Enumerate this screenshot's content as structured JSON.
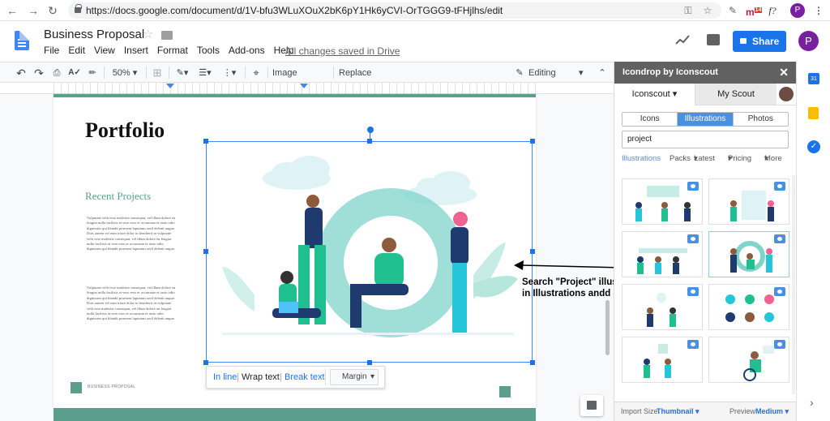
{
  "browser": {
    "url": "https://docs.google.com/document/d/1V-bfu3WLuXOuX2bK6pY1Hk6yCVI-OrTGGG9-tFHjlhs/edit",
    "ext_f": "f?",
    "ext_badge": "14",
    "profile_initial": "P"
  },
  "doc": {
    "title": "Business Proposal",
    "saved_status": "All changes saved in Drive",
    "share_label": "Share",
    "avatar_initial": "P"
  },
  "menu": [
    "File",
    "Edit",
    "View",
    "Insert",
    "Format",
    "Tools",
    "Add-ons",
    "Help"
  ],
  "toolbar": {
    "zoom": "50%",
    "image_options": "Image options...",
    "replace_image": "Replace image",
    "mode": "Editing"
  },
  "page": {
    "heading": "Portfolio",
    "subheading": "Recent Projects",
    "para1": "Vulputate velit esse molestie consequat, vel illum dolore eu feugiat nulla facilisis at vero eros et accumsan et iusto odio dignissim qui blandit praesent luptatum zzril delenit augue. Duis autem vel eum iriure dolor in hendrerit in vulputate velit esse molestie consequat, vel illum dolore eu feugiat nulla facilisis at vero eros et accumsan et iusto odio dignissim qui blandit praesent luptatum zzril delenit augue.",
    "para2": "Vulputate velit esse molestie consequat, vel illum dolore eu feugiat nulla facilisis at vero eros et accumsan et iusto odio dignissim qui blandit praesent luptatum zzril delenit augue. Duis autem vel eum iriure dolor in hendrerit in vulputate velit esse molestie consequat, vel illum dolore eu feugiat nulla facilisis at vero eros et accumsan et iusto odio dignissim qui blandit praesent luptatum zzril delenit augue.",
    "footer_label": "BUSINESS PROPOSAL"
  },
  "image_popup": {
    "in_line": "In line",
    "wrap_text": "Wrap text",
    "break_text": "Break text",
    "margin": "Margin"
  },
  "annotation": {
    "text": "Search \"Project\" illustration in Illustrations andd add it"
  },
  "panel": {
    "title": "Icondrop by Iconscout",
    "tab_iconscout": "Iconscout",
    "tab_myscout": "My Scout",
    "types": [
      "Icons",
      "Illustrations",
      "Photos"
    ],
    "active_type": "Illustrations",
    "search_value": "project",
    "filters": {
      "active": "Illustrations",
      "packs": "Packs",
      "latest": "Latest",
      "pricing": "Pricing",
      "more": "More"
    },
    "import_size_label": "Import Size",
    "import_size_value": "Thumbnail",
    "preview_label": "Preview",
    "preview_value": "Medium"
  },
  "colors": {
    "accent_teal": "#5b9e8d",
    "selection_blue": "#1a73e8",
    "share_blue": "#1a73e8",
    "panel_header": "#616161"
  }
}
